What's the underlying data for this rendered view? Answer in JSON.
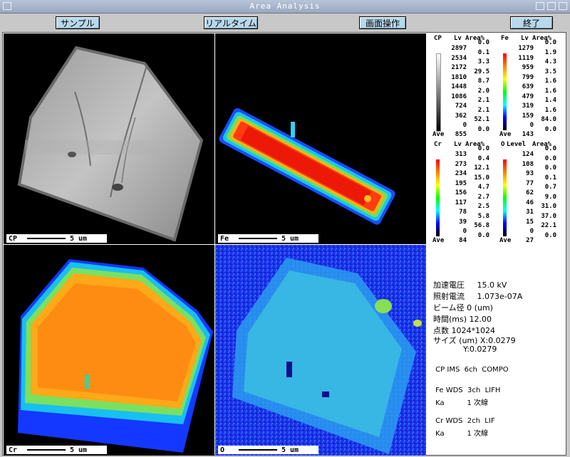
{
  "window": {
    "title": "Area  Analysis"
  },
  "toolbar": {
    "sample": "サンプル",
    "realtime": "リアルタイム",
    "screen_op": "画面操作",
    "quit": "終了"
  },
  "panels": {
    "cp": {
      "label": "CP",
      "scale": "5 um"
    },
    "fe": {
      "label": "Fe",
      "scale": "5 um"
    },
    "cr": {
      "label": "Cr",
      "scale": "5 um"
    },
    "o": {
      "label": "O",
      "scale": "5 um"
    }
  },
  "legends": {
    "cp": {
      "element": "CP",
      "lv_header": "Lv",
      "area_header": "Area%",
      "levels": [
        "2897",
        "2534",
        "2172",
        "1810",
        "1448",
        "1086",
        "724",
        "362",
        "0"
      ],
      "areas": [
        "0.0",
        "0.1",
        "3.3",
        "29.5",
        "8.7",
        "2.0",
        "2.1",
        "2.1",
        "52.1",
        "0.0"
      ],
      "ave_label": "Ave",
      "ave": "855"
    },
    "fe": {
      "element": "Fe",
      "lv_header": "Lv",
      "area_header": "Area%",
      "levels": [
        "1279",
        "1119",
        "959",
        "799",
        "639",
        "479",
        "319",
        "159",
        "0"
      ],
      "areas": [
        "0.0",
        "1.9",
        "4.3",
        "3.5",
        "1.6",
        "1.6",
        "1.4",
        "1.6",
        "84.0",
        "0.0"
      ],
      "ave_label": "Ave",
      "ave": "143"
    },
    "cr": {
      "element": "Cr",
      "lv_header": "Lv",
      "area_header": "Area%",
      "levels": [
        "313",
        "273",
        "234",
        "195",
        "156",
        "117",
        "78",
        "39",
        "0"
      ],
      "areas": [
        "0.0",
        "0.4",
        "12.1",
        "15.0",
        "4.7",
        "2.7",
        "2.5",
        "5.8",
        "56.8",
        "0.0"
      ],
      "ave_label": "Ave",
      "ave": "84"
    },
    "o": {
      "element": "O",
      "lv_header": "Level",
      "area_header": "Area%",
      "levels": [
        "124",
        "108",
        "93",
        "77",
        "62",
        "46",
        "31",
        "15",
        "0"
      ],
      "areas": [
        "0.0",
        "0.0",
        "0.0",
        "0.1",
        "0.7",
        "9.0",
        "31.0",
        "37.0",
        "22.1",
        "0.0"
      ],
      "ave_label": "Ave",
      "ave": "27"
    }
  },
  "info": {
    "voltage": "加速電圧     15.0 kV",
    "current": "照射電流     1.073e-07A",
    "beam": "ビーム径 0 (um)",
    "time": "時間(ms) 12.00",
    "points": "点数 1024*1024",
    "size_x": "サイズ (um) X:0.0279",
    "size_y": "            Y:0.0279"
  },
  "detectors": {
    "d1": " CP IMS  6ch  COMPO",
    "d2a": " Fe WDS  3ch  LIFH",
    "d2b": " Ka          1 次線",
    "d3a": " Cr WDS  2ch  LIF",
    "d3b": " Ka          1 次線"
  },
  "colors": {
    "button_bg": "#b8d8ec",
    "titlebar": "#9aa8c0"
  }
}
